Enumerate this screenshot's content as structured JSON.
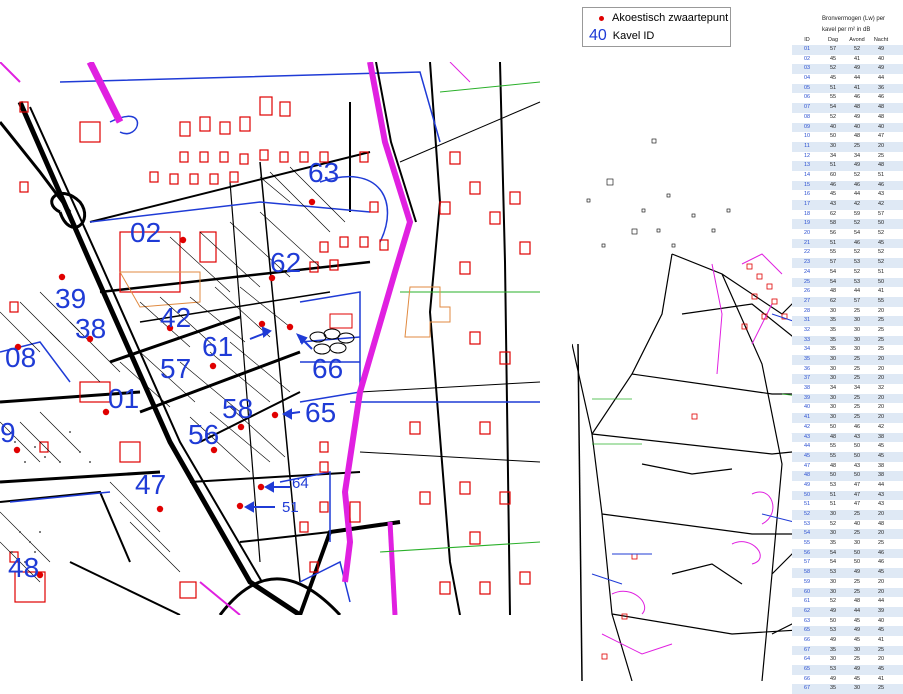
{
  "legend": {
    "point_label": "Akoestisch zwaartepunt",
    "id_sample": "40",
    "id_label": "Kavel ID"
  },
  "colors": {
    "red": "#e00000",
    "blue": "#1f3bd6",
    "magenta": "#e020e0",
    "black": "#000000"
  },
  "table": {
    "header_line1": "Bronvermogen (Lw) per",
    "header_line2": "kavel per m² in dB",
    "col_id": "ID",
    "col_dag": "Dag",
    "col_avond": "Avond",
    "col_nacht": "Nacht",
    "rows": [
      [
        "01",
        "57",
        "52",
        "49"
      ],
      [
        "02",
        "45",
        "41",
        "40"
      ],
      [
        "03",
        "52",
        "49",
        "49"
      ],
      [
        "04",
        "45",
        "44",
        "44"
      ],
      [
        "05",
        "51",
        "41",
        "36"
      ],
      [
        "06",
        "55",
        "46",
        "46"
      ],
      [
        "07",
        "54",
        "48",
        "48"
      ],
      [
        "08",
        "52",
        "49",
        "48"
      ],
      [
        "09",
        "40",
        "40",
        "40"
      ],
      [
        "10",
        "50",
        "48",
        "47"
      ],
      [
        "11",
        "30",
        "25",
        "20"
      ],
      [
        "12",
        "34",
        "34",
        "25"
      ],
      [
        "13",
        "51",
        "49",
        "48"
      ],
      [
        "14",
        "60",
        "52",
        "51"
      ],
      [
        "15",
        "46",
        "46",
        "46"
      ],
      [
        "16",
        "45",
        "44",
        "43"
      ],
      [
        "17",
        "43",
        "42",
        "42"
      ],
      [
        "18",
        "62",
        "59",
        "57"
      ],
      [
        "19",
        "58",
        "52",
        "50"
      ],
      [
        "20",
        "56",
        "54",
        "52"
      ],
      [
        "21",
        "51",
        "46",
        "45"
      ],
      [
        "22",
        "55",
        "52",
        "52"
      ],
      [
        "23",
        "57",
        "53",
        "52"
      ],
      [
        "24",
        "54",
        "52",
        "51"
      ],
      [
        "25",
        "54",
        "53",
        "50"
      ],
      [
        "26",
        "48",
        "44",
        "41"
      ],
      [
        "27",
        "62",
        "57",
        "55"
      ],
      [
        "28",
        "30",
        "25",
        "20"
      ],
      [
        "31",
        "35",
        "30",
        "25"
      ],
      [
        "32",
        "35",
        "30",
        "25"
      ],
      [
        "33",
        "35",
        "30",
        "25"
      ],
      [
        "34",
        "35",
        "30",
        "25"
      ],
      [
        "35",
        "30",
        "25",
        "20"
      ],
      [
        "36",
        "30",
        "25",
        "20"
      ],
      [
        "37",
        "30",
        "25",
        "20"
      ],
      [
        "38",
        "34",
        "34",
        "32"
      ],
      [
        "39",
        "30",
        "25",
        "20"
      ],
      [
        "40",
        "30",
        "25",
        "20"
      ],
      [
        "41",
        "30",
        "25",
        "20"
      ],
      [
        "42",
        "50",
        "46",
        "42"
      ],
      [
        "43",
        "48",
        "43",
        "38"
      ],
      [
        "44",
        "55",
        "50",
        "45"
      ],
      [
        "45",
        "55",
        "50",
        "45"
      ],
      [
        "47",
        "48",
        "43",
        "38"
      ],
      [
        "48",
        "50",
        "50",
        "38"
      ],
      [
        "49",
        "53",
        "47",
        "44"
      ],
      [
        "50",
        "51",
        "47",
        "43"
      ],
      [
        "51",
        "51",
        "47",
        "43"
      ],
      [
        "52",
        "30",
        "25",
        "20"
      ],
      [
        "53",
        "52",
        "40",
        "48"
      ],
      [
        "54",
        "30",
        "25",
        "20"
      ],
      [
        "55",
        "35",
        "30",
        "25"
      ],
      [
        "56",
        "54",
        "50",
        "46"
      ],
      [
        "57",
        "54",
        "50",
        "46"
      ],
      [
        "58",
        "53",
        "49",
        "45"
      ],
      [
        "59",
        "30",
        "25",
        "20"
      ],
      [
        "60",
        "30",
        "25",
        "20"
      ],
      [
        "61",
        "52",
        "48",
        "44"
      ],
      [
        "62",
        "49",
        "44",
        "39"
      ],
      [
        "63",
        "50",
        "45",
        "40"
      ],
      [
        "65",
        "53",
        "49",
        "45"
      ],
      [
        "66",
        "49",
        "45",
        "41"
      ],
      [
        "67",
        "35",
        "30",
        "25"
      ],
      [
        "64",
        "30",
        "25",
        "20"
      ],
      [
        "65",
        "53",
        "49",
        "45"
      ],
      [
        "66",
        "49",
        "45",
        "41"
      ],
      [
        "67",
        "35",
        "30",
        "25"
      ]
    ]
  },
  "map": {
    "kavels": [
      {
        "id": "63"
      },
      {
        "id": "02"
      },
      {
        "id": "62"
      },
      {
        "id": "39"
      },
      {
        "id": "42"
      },
      {
        "id": "38"
      },
      {
        "id": "61"
      },
      {
        "id": "08"
      },
      {
        "id": "57"
      },
      {
        "id": "66"
      },
      {
        "id": "01"
      },
      {
        "id": "58"
      },
      {
        "id": "65"
      },
      {
        "id": "56"
      },
      {
        "id": "9"
      },
      {
        "id": "64"
      },
      {
        "id": "47"
      },
      {
        "id": "51"
      },
      {
        "id": "48"
      }
    ]
  }
}
